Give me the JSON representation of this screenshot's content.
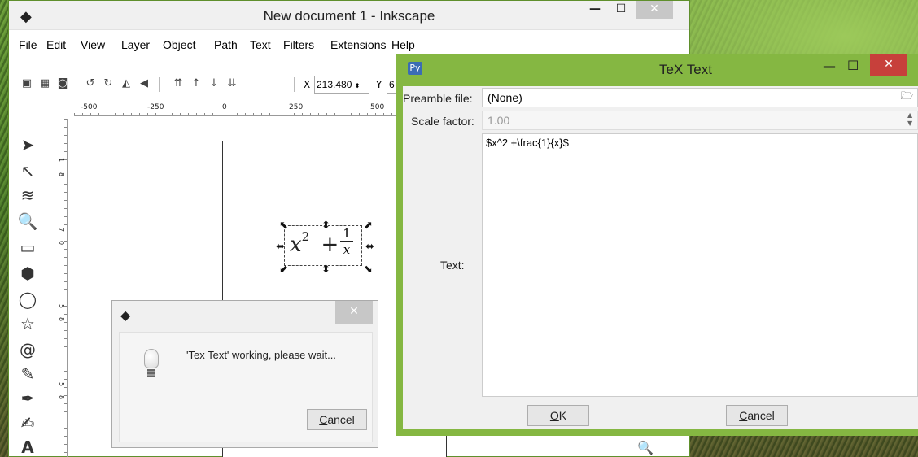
{
  "inkscape": {
    "title": "New document 1 - Inkscape",
    "controls": {
      "minimize": "—",
      "maximize": "☐",
      "close": "✕"
    },
    "menu": [
      "File",
      "Edit",
      "View",
      "Layer",
      "Object",
      "Path",
      "Text",
      "Filters",
      "Extensions",
      "Help"
    ],
    "toolbar": {
      "x_label": "X",
      "x_value": "213.480",
      "y_label": "Y",
      "y_value": "6"
    },
    "ruler_h": [
      "-500",
      "-250",
      "0",
      "250",
      "500"
    ],
    "ruler_v": [
      "1",
      "8",
      "7",
      "0",
      "5",
      "8",
      "5",
      "8"
    ],
    "formula": {
      "x": "x",
      "exp": "2",
      "plus": "+",
      "num": "1",
      "den": "x"
    }
  },
  "textex": {
    "title": "TeX Text",
    "controls": {
      "minimize": "—",
      "maximize": "☐",
      "close": "✕"
    },
    "preamble_label": "Preamble file:",
    "preamble_value": "(None)",
    "scale_label": "Scale factor:",
    "scale_value": "1.00",
    "text_label": "Text:",
    "text_value": "$x^2 +\\frac{1}{x}$",
    "ok_label": "OK",
    "cancel_label": "Cancel"
  },
  "popup": {
    "close": "✕",
    "message": "'Tex Text' working, please wait...",
    "cancel_label": "Cancel"
  }
}
